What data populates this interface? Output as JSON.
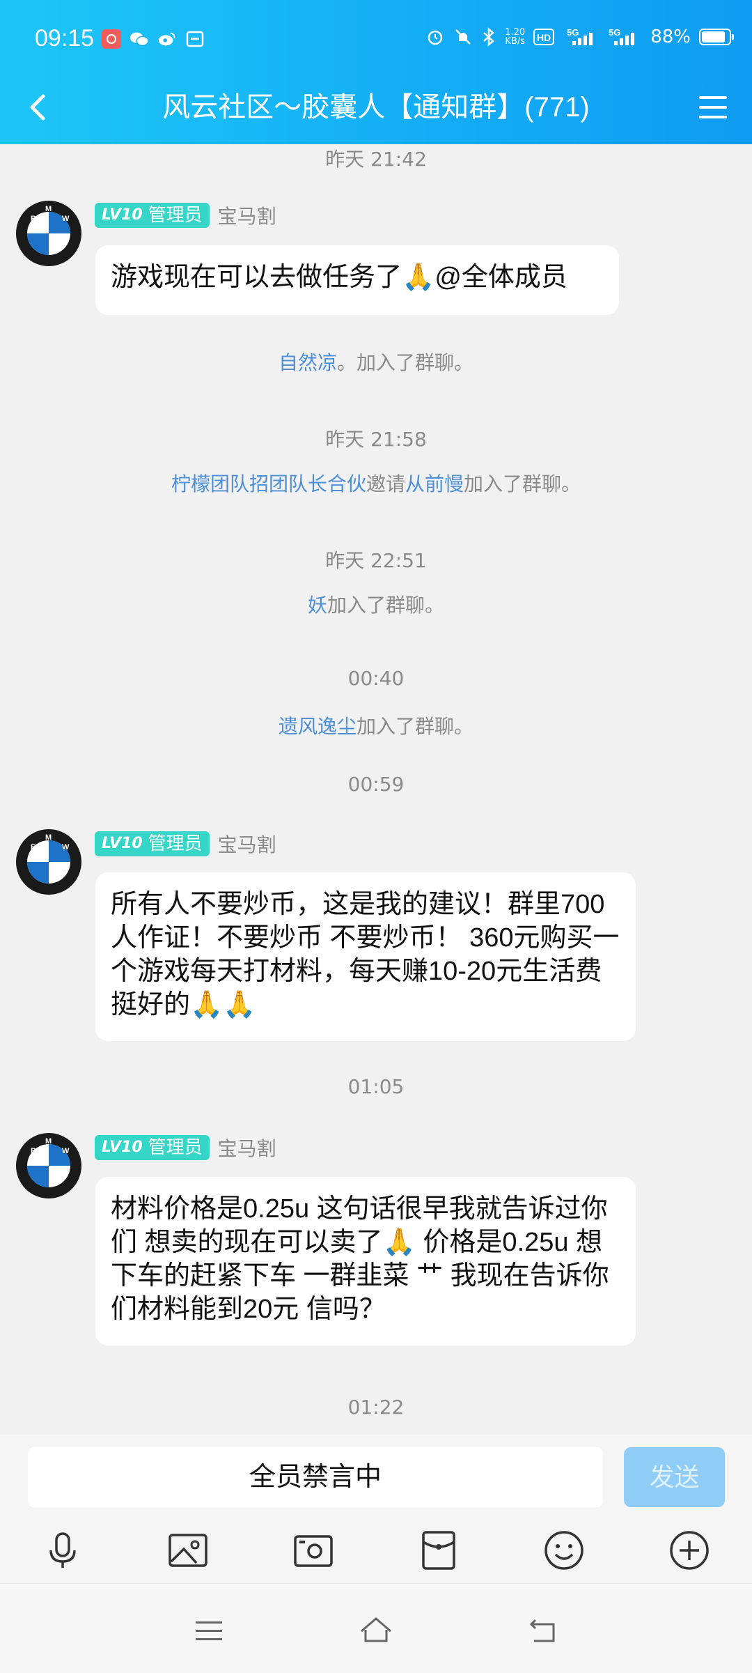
{
  "status_bar": {
    "time": "09:15",
    "net_speed": "1.20\nKB/s",
    "battery": "88%",
    "battery_level": 0.88,
    "signal1_label": "5G",
    "signal2_label": "5G",
    "hd_label": "HD"
  },
  "header": {
    "title": "风云社区～胶囊人【通知群】(771)",
    "bg_color": "#14aef5"
  },
  "messages": {
    "t1": "昨天 21:42",
    "m1": {
      "badge_level": "LV10",
      "badge_role": "管理员",
      "sender": "宝马割",
      "text": "游戏现在可以去做任务了🙏@全体成员"
    },
    "s1": {
      "name": "自然凉",
      "text": "。加入了群聊。"
    },
    "t2": "昨天 21:58",
    "s2": {
      "name1": "柠檬团队招团队长合伙",
      "mid": "邀请",
      "name2": "从前慢",
      "text": "加入了群聊。"
    },
    "t3": "昨天 22:51",
    "s3": {
      "name": "妖",
      "text": "加入了群聊。"
    },
    "t4": "00:40",
    "s4": {
      "name": "遗风逸尘",
      "text": "加入了群聊。"
    },
    "t5": "00:59",
    "m2": {
      "badge_level": "LV10",
      "badge_role": "管理员",
      "sender": "宝马割",
      "text": "所有人不要炒币，这是我的建议！群里700人作证！不要炒币 不要炒币！ 360元购买一个游戏每天打材料，每天赚10-20元生活费挺好的🙏🙏"
    },
    "t6": "01:05",
    "m3": {
      "badge_level": "LV10",
      "badge_role": "管理员",
      "sender": "宝马割",
      "text": "材料价格是0.25u 这句话很早我就告诉过你们 想卖的现在可以卖了🙏 价格是0.25u   想下车的赶紧下车 一群韭菜 艹 我现在告诉你们材料能到20元 信吗？"
    },
    "t7": "01:22"
  },
  "input": {
    "muted_text": "全员禁言中",
    "send_label": "发送"
  },
  "toolbar": {
    "icons": [
      "microphone-icon",
      "image-icon",
      "camera-icon",
      "red-packet-icon",
      "emoji-icon",
      "plus-icon"
    ]
  },
  "navbar": {
    "icons": [
      "menu-icon",
      "home-icon",
      "back-icon"
    ]
  }
}
